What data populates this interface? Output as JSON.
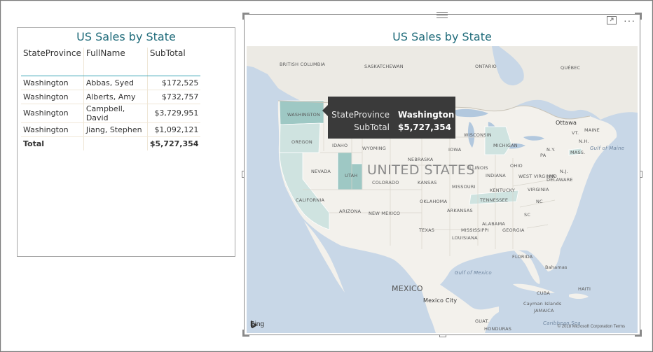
{
  "table": {
    "title": "US Sales by State",
    "columns": [
      "StateProvince",
      "FullName",
      "SubTotal"
    ],
    "rows": [
      {
        "state": "Washington",
        "name": "Abbas, Syed",
        "subtotal": "$172,525"
      },
      {
        "state": "Washington",
        "name": "Alberts, Amy",
        "subtotal": "$732,757"
      },
      {
        "state": "Washington",
        "name": "Campbell, David",
        "subtotal": "$3,729,951"
      },
      {
        "state": "Washington",
        "name": "Jiang, Stephen",
        "subtotal": "$1,092,121"
      }
    ],
    "total": {
      "label": "Total",
      "subtotal": "$5,727,354"
    }
  },
  "map": {
    "title": "US Sales by State",
    "country_label": "UNITED STATES",
    "mexico_label": "MEXICO",
    "labels": {
      "british_columbia": "BRITISH COLUMBIA",
      "saskatchewan": "SASKATCHEWAN",
      "ontario": "ONTARIO",
      "quebec": "QUÉBEC",
      "washington": "WASHINGTON",
      "oregon": "OREGON",
      "idaho": "IDAHO",
      "wyoming": "WYOMING",
      "nevada": "NEVADA",
      "utah": "UTAH",
      "colorado": "COLORADO",
      "california": "CALIFORNIA",
      "arizona": "ARIZONA",
      "new_mexico": "NEW MEXICO",
      "texas": "TEXAS",
      "nebraska": "NEBRASKA",
      "kansas": "KANSAS",
      "oklahoma": "OKLAHOMA",
      "iowa": "IOWA",
      "missouri": "MISSOURI",
      "arkansas": "ARKANSAS",
      "louisiana": "LOUISIANA",
      "mississippi": "MISSISSIPPI",
      "alabama": "ALABAMA",
      "georgia": "GEORGIA",
      "florida": "FLORIDA",
      "tennessee": "TENNESSEE",
      "kentucky": "KENTUCKY",
      "illinois": "ILLINOIS",
      "indiana": "INDIANA",
      "ohio": "OHIO",
      "wisconsin": "WISCONSIN",
      "michigan": "MICHIGAN",
      "west_virginia": "WEST VIRGINIA",
      "virginia": "VIRGINIA",
      "pa": "PA",
      "ny": "N.Y.",
      "nj": "N.J.",
      "md": "MD",
      "de": "DELAWARE",
      "nc": "NC",
      "sc": "SC",
      "maine": "MAINE",
      "vt": "VT.",
      "nh": "N.H.",
      "mass": "MASS.",
      "ottawa": "Ottawa",
      "mexico_city": "Mexico City",
      "gulf_mexico": "Gulf of Mexico",
      "gulf_maine": "Gulf of Maine",
      "bahamas": "Bahamas",
      "cuba": "CUBA",
      "cayman": "Cayman Islands",
      "haiti": "HAITI",
      "jamaica": "JAMAICA",
      "caribbean": "Caribbean Sea",
      "honduras": "HONDURAS",
      "guatemala": "GUAT."
    },
    "bing_label": "Bing",
    "copyright": "© 2018 Microsoft Corporation  Terms",
    "tooltip": {
      "key1": "StateProvince",
      "val1": "Washington",
      "key2": "SubTotal",
      "val2": "$5,727,354"
    },
    "colors": {
      "water": "#c8d7e7",
      "land": "#f3f1ec",
      "canada": "#eceae4",
      "highlight_strong": "#9ec8c4",
      "highlight_light": "#cfe3e0",
      "accent_line": "#35a1b5",
      "title": "#1f6b7a"
    }
  }
}
